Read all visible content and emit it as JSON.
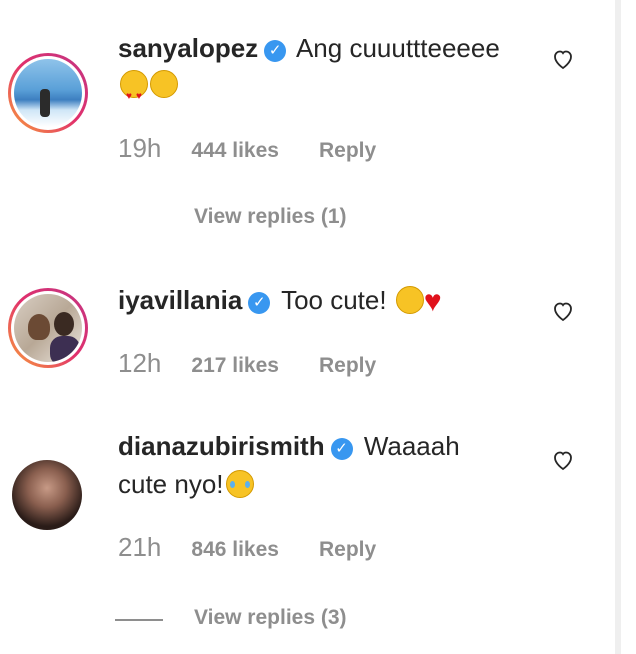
{
  "comments": [
    {
      "username": "sanyalopez",
      "text": "Ang cuuuttteeeee",
      "emojis": [
        "heart-eyes-emoji",
        "hugging-emoji"
      ],
      "time": "19h",
      "likes": "444 likes",
      "reply_label": "Reply",
      "view_replies": "View replies (1)"
    },
    {
      "username": "iyavillania",
      "text": "Too cute!",
      "emojis": [
        "grinning-squint-emoji",
        "red-heart-emoji"
      ],
      "time": "12h",
      "likes": "217 likes",
      "reply_label": "Reply"
    },
    {
      "username": "dianazubirismith",
      "text": "Waaaah",
      "text_line2": "cute nyo!",
      "emojis": [
        "joy-emoji"
      ],
      "time": "21h",
      "likes": "846 likes",
      "reply_label": "Reply",
      "view_replies": "View replies (3)"
    }
  ],
  "colors": {
    "verified": "#3897f0",
    "meta_text": "#8e8e8e",
    "story_ring_start": "#f9a13a",
    "story_ring_end": "#c13584"
  }
}
